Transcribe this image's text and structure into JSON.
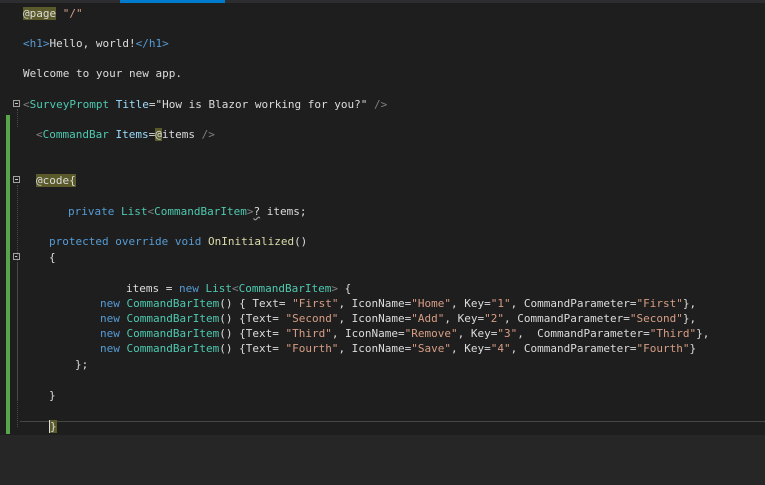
{
  "code": {
    "page_dir": "@page",
    "page_route": "\"/\"",
    "h1_open": "<h1>",
    "h1_text": "Hello, world!",
    "h1_close": "</h1>",
    "welcome": "Welcome to your new app.",
    "survey": {
      "open": "<",
      "name": "SurveyPrompt",
      "attr": "Title",
      "eq": "=",
      "value": "\"How is Blazor working for you?\"",
      "close": " />"
    },
    "commandbar": {
      "open": "<",
      "name": "CommandBar",
      "attr": "Items",
      "eq": "=",
      "at": "@",
      "ident": "items",
      "close": " />"
    },
    "code_dir": "@code",
    "code_brace": "{",
    "field": {
      "kw": "private",
      "type": "List",
      "lt": "<",
      "generic": "CommandBarItem",
      "gt": ">",
      "q": "?",
      "rest": " items;"
    },
    "method": {
      "kw1": "protected",
      "kw2": "override",
      "kw3": "void",
      "name": "OnInitialized",
      "parens": "()"
    },
    "open_brace": "{",
    "assign": {
      "lhs": "items = ",
      "kw": "new",
      "type": "List",
      "lt": "<",
      "generic": "CommandBarItem",
      "gt": ">",
      "tail": " {"
    },
    "items": [
      {
        "pre": "() { Text= ",
        "text": "\"First\"",
        "icon_key": ", IconName=",
        "icon": "\"Home\"",
        "key_key": ", Key=",
        "key": "\"1\"",
        "param_key": ", CommandParameter=",
        "param": "\"First\"",
        "end": "},"
      },
      {
        "pre": "() {Text= ",
        "text": "\"Second\"",
        "icon_key": ", IconName=",
        "icon": "\"Add\"",
        "key_key": ", Key=",
        "key": "\"2\"",
        "param_key": ", CommandParameter=",
        "param": "\"Second\"",
        "end": "},"
      },
      {
        "pre": "() {Text= ",
        "text": "\"Third\"",
        "icon_key": ", IconName=",
        "icon": "\"Remove\"",
        "key_key": ", Key=",
        "key": "\"3\"",
        "param_key": ",  CommandParameter=",
        "param": "\"Third\"",
        "end": "},"
      },
      {
        "pre": "() {Text= ",
        "text": "\"Fourth\"",
        "icon_key": ", IconName=",
        "icon": "\"Save\"",
        "key_key": ", Key=",
        "key": "\"4\"",
        "param_key": ", CommandParameter=",
        "param": "\"Fourth\"",
        "end": "}"
      }
    ],
    "items_kw": "new",
    "items_type": "CommandBarItem",
    "list_end": "};",
    "method_close": "}",
    "code_close": "}"
  },
  "colors": {
    "background": "#1e1e1e",
    "keyword": "#569cd6",
    "type": "#4ec9b0",
    "string": "#d69d85",
    "attribute": "#9cdcfe",
    "method": "#dcdcaa",
    "directive_highlight": "#5a5a2a",
    "change_bar": "#57a64a"
  }
}
